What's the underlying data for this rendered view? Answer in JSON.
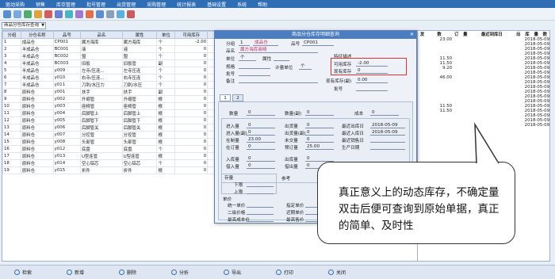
{
  "menu": [
    "驱动采购",
    "销售",
    "库存管理",
    "批号管理",
    "出货管理",
    "采购管理",
    "统计报表",
    "基础设置",
    "系统",
    "帮助"
  ],
  "filter": {
    "value": "商品分仓库存查询"
  },
  "table": {
    "headers": [
      "分组",
      "分仓名称",
      "品号",
      "品名",
      "属性",
      "单位",
      "可用库存",
      "现有库存"
    ],
    "rows": [
      [
        "1",
        "成品仓",
        "CP001",
        "属方海库",
        "属方海库",
        "个",
        "-2.00",
        ""
      ],
      [
        "2",
        "半成品仓",
        "BC001",
        "液",
        "液",
        "个",
        "0",
        ""
      ],
      [
        "3",
        "半成品仓",
        "BC002",
        "盟",
        "盟",
        "个",
        "0",
        ""
      ],
      [
        "4",
        "半成品仓",
        "BC003",
        "旧扳",
        "旧扳管",
        "副",
        "0",
        ""
      ],
      [
        "5",
        "半成品仓",
        "y009",
        "左寺/压连...",
        "左寺压连",
        "个",
        "0",
        ""
      ],
      [
        "6",
        "半成品仓",
        "y010",
        "右寺/压连...",
        "右寺压连",
        "个",
        "0",
        ""
      ],
      [
        "7",
        "半成品仓",
        "y011",
        "刀刺/水压力",
        "刀刺/水压",
        "个",
        "0",
        ""
      ],
      [
        "8",
        "原料仓",
        "y001",
        "扶手",
        "扶手",
        "副",
        "0",
        ""
      ],
      [
        "9",
        "原料仓",
        "y002",
        "升缩管",
        "升缩管",
        "根",
        "0",
        "46"
      ],
      [
        "10",
        "原料仓",
        "y003",
        "座椅管",
        "座椅管",
        "根",
        "0",
        ""
      ],
      [
        "11",
        "原料仓",
        "y004",
        "后脚管上",
        "后脚管上",
        "根",
        "0",
        ""
      ],
      [
        "12",
        "原料仓",
        "y005",
        "后脚管下",
        "后脚管下",
        "根",
        "0",
        ""
      ],
      [
        "13",
        "原料仓",
        "y006",
        "后脚管关",
        "后脚管关",
        "根",
        "0",
        ""
      ],
      [
        "14",
        "原料仓",
        "y007",
        "分控管",
        "分控管",
        "根",
        "0",
        ""
      ],
      [
        "15",
        "原料仓",
        "y008",
        "头部管",
        "头部管",
        "根",
        "0",
        ""
      ],
      [
        "16",
        "原料仓",
        "y012",
        "底盘",
        "底盘",
        "个",
        "0",
        ""
      ],
      [
        "17",
        "原料仓",
        "y013",
        "U型连管",
        "U型连管",
        "根",
        "0",
        ""
      ],
      [
        "18",
        "原料仓",
        "y014",
        "空心铝芯",
        "空心铝芯",
        "个",
        "0",
        ""
      ],
      [
        "19",
        "原料仓",
        "y015",
        "折件",
        "折件",
        "根",
        "0",
        ""
      ]
    ]
  },
  "right_table": {
    "headers": [
      "发",
      "数",
      "订",
      "量",
      "最近到库日",
      "出",
      "库",
      "量",
      "数"
    ],
    "rows": [
      [
        "",
        "23.00",
        "",
        "",
        "2018-05-09"
      ],
      [
        "",
        "",
        "",
        "",
        "2018-05-09"
      ],
      [
        "",
        "",
        "",
        "",
        "2018-05-09"
      ],
      [
        "",
        "",
        "",
        "",
        "2018-05-09"
      ],
      [
        "",
        "11.50",
        "",
        "",
        "2018-05-09"
      ],
      [
        "",
        "11.50",
        "",
        "",
        "2018-05-09"
      ],
      [
        "",
        "9.20",
        "",
        "",
        "2018-05-09"
      ],
      [
        "",
        "",
        "",
        "",
        "2018-05-09"
      ],
      [
        "",
        "46.00",
        "",
        "",
        "2018-05-09"
      ],
      [
        "",
        "",
        "",
        "",
        "2018-05-09"
      ],
      [
        "",
        "",
        "",
        "",
        "2018-05-09"
      ],
      [
        "",
        "",
        "",
        "",
        "2018-05-09"
      ],
      [
        "",
        "",
        "",
        "",
        "2018-05-09"
      ],
      [
        "",
        "",
        "",
        "",
        "2018-05-09"
      ],
      [
        "",
        "11.50",
        "",
        "",
        "2018-05-09"
      ],
      [
        "",
        "11.50",
        "",
        "",
        "2018-05-09"
      ],
      [
        "",
        "",
        "",
        "",
        "2018-05-09"
      ],
      [
        "",
        "",
        "",
        "",
        "2018-05-09"
      ],
      [
        "",
        "",
        "",
        "",
        "2018-05-09"
      ]
    ]
  },
  "dialog": {
    "title": "商品分仓库存明细查询",
    "group_label": "分组",
    "group_value": "1",
    "warehouse_value": "成品仓",
    "code_label": "品号",
    "code_value": "CP001",
    "name_label": "品名",
    "name_value": "属方海库商晴",
    "unit_label": "单位",
    "unit_value": "个",
    "spec_label": "规格",
    "attr_label": "属性",
    "note_label": "备注",
    "feature_label": "特征描述",
    "calc_unit_label": "计量单位",
    "calc_unit_value": "个",
    "avail_label": "可用库存",
    "avail_value": "-2.00",
    "onhand_label": "现有库存",
    "onhand_value": "0",
    "cur_avail_label": "现有库存(副)",
    "cur_avail_value": "0.00",
    "batch_label": "批号",
    "tab1": "1",
    "tab2": "2",
    "qty_label": "数量",
    "qty_value": "0",
    "inv_label": "数量(副)",
    "inv_value": "0",
    "cost_label": "成本",
    "cost_value": "0",
    "in_label": "进入量",
    "in_value": "0",
    "in2_label": "进入量(副)",
    "in2_value": "0",
    "make_label": "在制量",
    "make_value": "23.00",
    "order_label": "在订量",
    "order_value": "0",
    "out_label": "出货量",
    "out_value": "0",
    "out2_label": "出货量(副)",
    "out2_value": "0",
    "inbound_label": "未交量",
    "inbound_value": "0",
    "reserve_label": "预订量",
    "reserve_value": "25.00",
    "last_out_label": "最近出库日",
    "last_out_value": "2018-05-09",
    "last_in_label": "最近入库日",
    "last_in_value": "2018-05-09",
    "last_sale_label": "最近销售日",
    "produce_label": "生产日期",
    "store_in_label": "入库量",
    "store_in_value": "0",
    "store_out_label": "出库量",
    "store_out_value": "0",
    "loan_label": "借入量",
    "loan_value": "0",
    "loan_out_label": "借出量",
    "loan_out_value": "0",
    "stock_label": "存量",
    "lower_label": "下限",
    "upper_label": "上限",
    "unit_price_label": "单价",
    "unit_price_sub": "统一单价",
    "ref_label": "参考",
    "price_label": "二级价格",
    "warehouse_label": "二期价格",
    "avg_cost_label": "最高成本价",
    "unique_label": "指定单价",
    "recent_label": "近期单价",
    "pending_label": "最高售价"
  },
  "callout": {
    "text": "真正意义上的动态库存，不确定量双击后便可查询到原始单据，真正的简单、及时性"
  },
  "bottom_buttons": [
    "检索",
    "新增",
    "删除",
    "分析",
    "导出",
    "打印",
    "关闭"
  ]
}
